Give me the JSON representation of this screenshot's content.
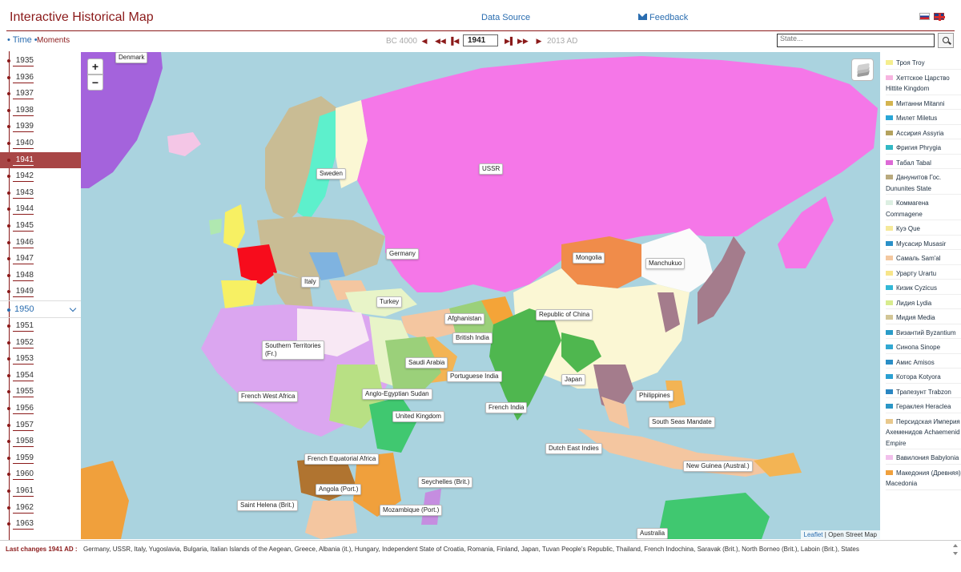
{
  "header": {
    "title": "Interactive Historical Map",
    "data_source_label": "Data Source",
    "feedback_label": "Feedback",
    "feedback_icon": "envelope-icon",
    "languages": [
      "ru",
      "en"
    ]
  },
  "controls": {
    "tab_time": "• Time •",
    "tab_moments": "Moments",
    "range_start": "BC 4000",
    "current_year": "1941",
    "range_end": "2013 AD",
    "search_placeholder": "State..."
  },
  "timeline": {
    "years": [
      "1935",
      "1936",
      "1937",
      "1938",
      "1939",
      "1940",
      "1941",
      "1942",
      "1943",
      "1944",
      "1945",
      "1946",
      "1947",
      "1948",
      "1949"
    ],
    "active_year": "1941",
    "decade": "1950",
    "years_after": [
      "1951",
      "1952",
      "1953",
      "1954",
      "1955",
      "1956",
      "1957",
      "1958",
      "1959",
      "1960",
      "1961",
      "1962",
      "1963"
    ]
  },
  "map": {
    "zoom_in": "+",
    "zoom_out": "−",
    "labels": {
      "denmark": "Denmark",
      "sweden": "Sweden",
      "ussr": "USSR",
      "germany": "Germany",
      "italy": "Italy",
      "turkey": "Turkey",
      "mongolia": "Mongolia",
      "manchukuo": "Manchukuo",
      "republic_of_china": "Republic of China",
      "afghanistan": "Afghanistan",
      "british_india": "British India",
      "saudi_arabia": "Saudi Arabia",
      "portuguese_india": "Portuguese India",
      "southern_territories": "Southern Territories\n(Fr.)",
      "french_west_africa": "French West Africa",
      "anglo_egyptian_sudan": "Anglo-Egyptian Sudan",
      "united_kingdom": "United Kingdom",
      "japan": "Japan",
      "philippines": "Philippines",
      "french_india": "French India",
      "south_seas_mandate": "South Seas Mandate",
      "dutch_east_indies": "Dutch East Indies",
      "french_equatorial_africa": "French Equatorial Africa",
      "angola": "Angola (Port.)",
      "seychelles": "Seychelles (Brit.)",
      "saint_helena": "Saint Helena (Brit.)",
      "mozambique": "Mozambique (Port.)",
      "new_guinea": "New Guinea (Austral.)",
      "australia": "Australia"
    },
    "attribution_leaflet": "Leaflet",
    "attribution_osm": "| Open Street Map",
    "colors": {
      "sea": "#aad3df",
      "ussr": "#f577e8",
      "china": "#fbf7d4",
      "germany": "#c9bc94",
      "india": "#4fb74f",
      "france": "#f70c1c",
      "saudi": "#f3b454",
      "mongolia": "#f08c4a",
      "french_west_africa": "#dba6f0",
      "denmark_greenland": "#a463dc"
    }
  },
  "legend": [
    {
      "label": "Троя Troy",
      "color": "#f5ee8e"
    },
    {
      "label": "Хеттское Царство Hittite Kingdom",
      "color": "#f7b4e0"
    },
    {
      "label": "Митанни Mitanni",
      "color": "#d4b44f"
    },
    {
      "label": "Милет Miletus",
      "color": "#2aa6d6"
    },
    {
      "label": "Ассирия Assyria",
      "color": "#b4a25e"
    },
    {
      "label": "Фригия Phrygia",
      "color": "#32b8c4"
    },
    {
      "label": "Табал Tabal",
      "color": "#dd6ad6"
    },
    {
      "label": "Данунитов Гос. Dununites State",
      "color": "#b9aa7e"
    },
    {
      "label": "Коммагена Commagene",
      "color": "#dcefe2"
    },
    {
      "label": "Куэ Que",
      "color": "#f5e99a"
    },
    {
      "label": "Мусасир Musasir",
      "color": "#2a90c8"
    },
    {
      "label": "Самаль Sam'al",
      "color": "#f4c8a0"
    },
    {
      "label": "Урарту Urartu",
      "color": "#f7e58a"
    },
    {
      "label": "Кизик Cyzicus",
      "color": "#33b8d6"
    },
    {
      "label": "Лидия Lydia",
      "color": "#d8ec8e"
    },
    {
      "label": "Мидия Media",
      "color": "#d2c696"
    },
    {
      "label": "Византий Byzantium",
      "color": "#2a9cc8"
    },
    {
      "label": "Синопа Sinope",
      "color": "#32a8d2"
    },
    {
      "label": "Амис Amisos",
      "color": "#2a8ec6"
    },
    {
      "label": "Которa Kotyora",
      "color": "#2aa0d2"
    },
    {
      "label": "Трапезунт Trabzon",
      "color": "#2a86c2"
    },
    {
      "label": "Гераклея Heraclea",
      "color": "#2a96c6"
    },
    {
      "label": "Персидская Империя Ахеменидов Achaemenid Empire",
      "color": "#e8c88c"
    },
    {
      "label": "Вавилония Babylonia",
      "color": "#f2c0ec"
    },
    {
      "label": "Македония (Древняя) Macedonia",
      "color": "#f0a03c"
    }
  ],
  "footer": {
    "last_changes_label": "Last changes 1941 AD :",
    "last_changes_list": "Germany, USSR, Italy, Yugoslavia, Bulgaria, Italian Islands of the Aegean, Greece, Albania (it.), Hungary, Independent State of Croatia, Romania, Finland, Japan, Tuvan People's Republic, Thailand, French Indochina, Saravak (Brit.), North Borneo (Brit.), Laboin (Brit.), States"
  }
}
